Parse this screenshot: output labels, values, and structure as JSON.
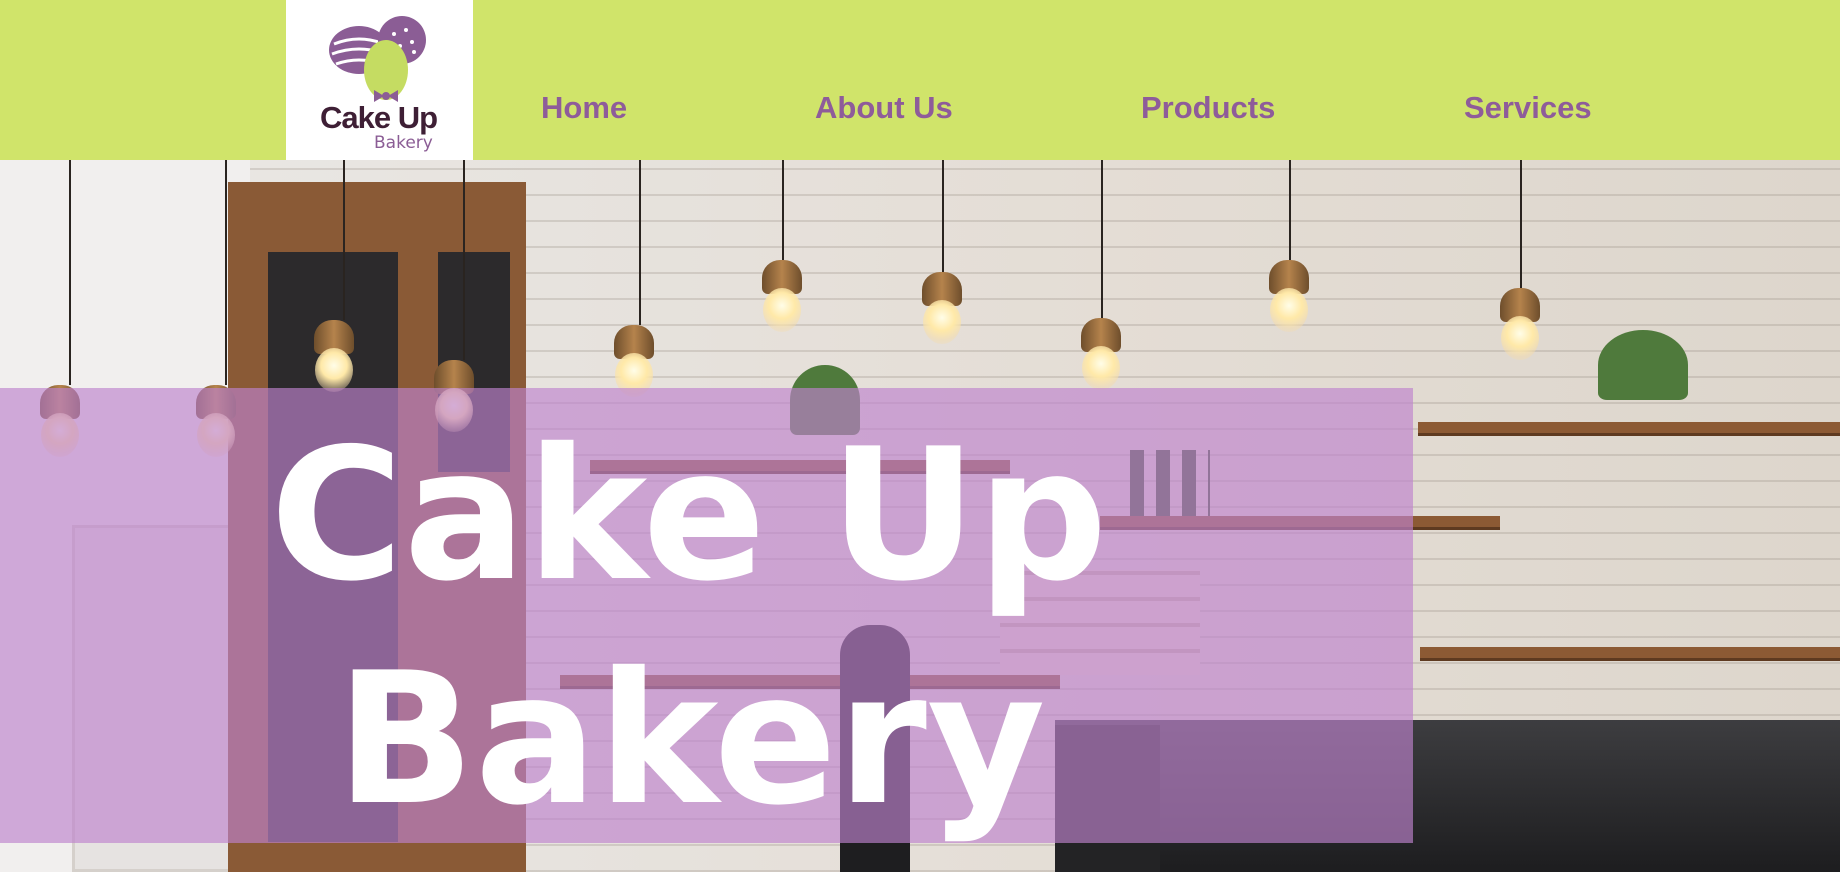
{
  "brand": {
    "logo_name": "Cake Up",
    "logo_sub": "Bakery",
    "colors": {
      "header_bg": "#d0e46a",
      "nav_text": "#8e5c9a",
      "logo_purple": "#8b5d95",
      "logo_dark": "#3e1f35",
      "overlay": "#be82cd"
    }
  },
  "nav": {
    "items": [
      {
        "label": "Home"
      },
      {
        "label": "About Us"
      },
      {
        "label": "Products"
      },
      {
        "label": "Services"
      }
    ]
  },
  "hero": {
    "title_line1": "Cake Up",
    "title_line2": "Bakery",
    "background": "cafe-interior-photo"
  }
}
